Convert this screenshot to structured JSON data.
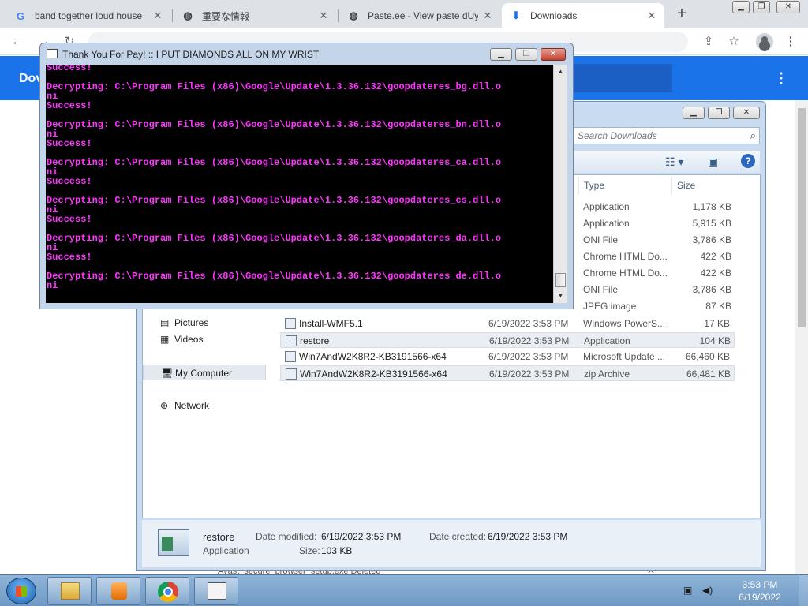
{
  "browser": {
    "tabs": [
      {
        "title": "band together loud house",
        "icon": "google-g-icon"
      },
      {
        "title": "重要な情報",
        "icon": "globe-icon"
      },
      {
        "title": "Paste.ee - View paste dUy",
        "icon": "globe-icon"
      },
      {
        "title": "Downloads",
        "icon": "download-icon",
        "active": true
      }
    ],
    "new_tab_label": "+",
    "page_header_title": "Dov",
    "notice_text": "Avast_secure_browser_setup.exe  Deleted"
  },
  "console": {
    "title": "Thank You For Pay! :: I PUT DIAMONDS ALL ON MY WRIST",
    "text_color": "#ff35ff",
    "lines": [
      "Success!",
      "",
      "Decrypting: C:\\Program Files (x86)\\Google\\Update\\1.3.36.132\\goopdateres_bg.dll.o",
      "ni",
      "Success!",
      "",
      "Decrypting: C:\\Program Files (x86)\\Google\\Update\\1.3.36.132\\goopdateres_bn.dll.o",
      "ni",
      "Success!",
      "",
      "Decrypting: C:\\Program Files (x86)\\Google\\Update\\1.3.36.132\\goopdateres_ca.dll.o",
      "ni",
      "Success!",
      "",
      "Decrypting: C:\\Program Files (x86)\\Google\\Update\\1.3.36.132\\goopdateres_cs.dll.o",
      "ni",
      "Success!",
      "",
      "Decrypting: C:\\Program Files (x86)\\Google\\Update\\1.3.36.132\\goopdateres_da.dll.o",
      "ni",
      "Success!",
      "",
      "Decrypting: C:\\Program Files (x86)\\Google\\Update\\1.3.36.132\\goopdateres_de.dll.o",
      "ni"
    ]
  },
  "explorer": {
    "search_placeholder": "Search Downloads",
    "columns": {
      "type": "Type",
      "size": "Size"
    },
    "nav": [
      {
        "label": "Pictures",
        "icon": "pictures-folder-icon"
      },
      {
        "label": "Videos",
        "icon": "videos-folder-icon"
      },
      {
        "label": "My Computer",
        "icon": "computer-icon"
      },
      {
        "label": "Network",
        "icon": "network-icon"
      }
    ],
    "upper_rows": [
      {
        "type": "Application",
        "size": "1,178 KB"
      },
      {
        "type": "Application",
        "size": "5,915 KB"
      },
      {
        "type": "ONI File",
        "size": "3,786 KB"
      },
      {
        "type": "Chrome HTML Do...",
        "size": "422 KB"
      },
      {
        "type": "Chrome HTML Do...",
        "size": "422 KB"
      },
      {
        "type": "ONI File",
        "size": "3,786 KB"
      },
      {
        "type": "JPEG image",
        "size": "87 KB"
      }
    ],
    "files": [
      {
        "name": "Install-WMF5.1",
        "date": "6/19/2022 3:53 PM",
        "type": "Windows PowerS...",
        "size": "17 KB"
      },
      {
        "name": "restore",
        "date": "6/19/2022 3:53 PM",
        "type": "Application",
        "size": "104 KB",
        "highlight": true
      },
      {
        "name": "Win7AndW2K8R2-KB3191566-x64",
        "date": "6/19/2022 3:53 PM",
        "type": "Microsoft Update ...",
        "size": "66,460 KB"
      },
      {
        "name": "Win7AndW2K8R2-KB3191566-x64",
        "date": "6/19/2022 3:53 PM",
        "type": "zip Archive",
        "size": "66,481 KB",
        "highlight": true
      }
    ],
    "details": {
      "name": "restore",
      "kind": "Application",
      "modified_label": "Date modified:",
      "modified": "6/19/2022 3:53 PM",
      "created_label": "Date created:",
      "created": "6/19/2022 3:53 PM",
      "size_label": "Size:",
      "size": "103 KB"
    }
  },
  "taskbar": {
    "time": "3:53 PM",
    "date": "6/19/2022"
  }
}
